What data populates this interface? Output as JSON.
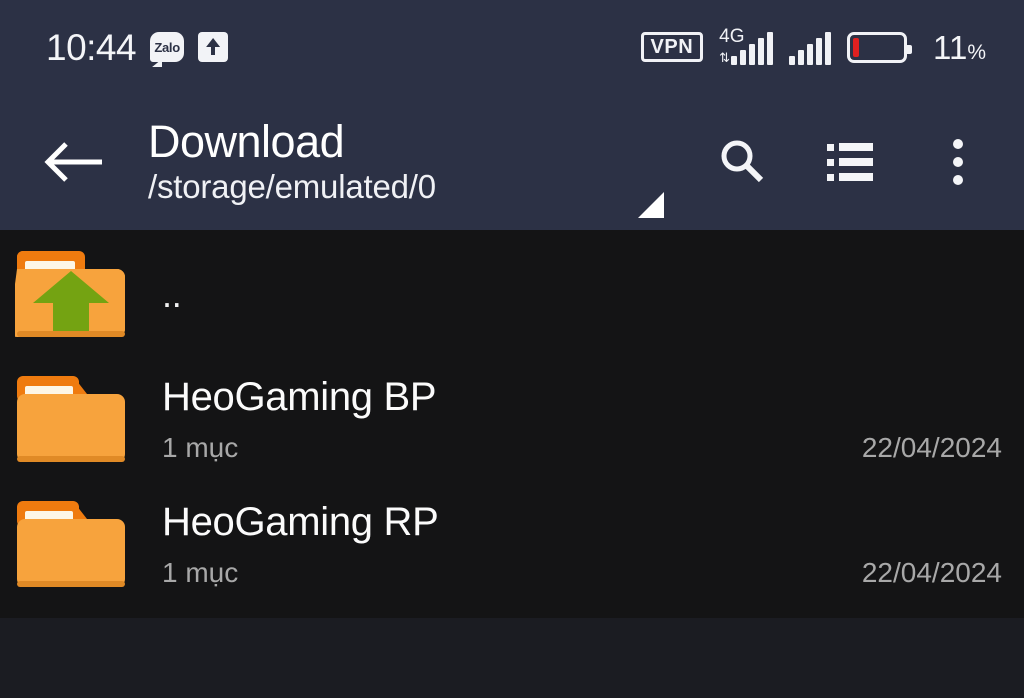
{
  "status_bar": {
    "clock": "10:44",
    "zalo_label": "Zalo",
    "upload_icon": "upload-arrow-icon",
    "vpn_label": "VPN",
    "network_generation": "4G",
    "data_arrows": "⇅",
    "signal_bars_1": 5,
    "signal_bars_2": 5,
    "battery_percent": "11",
    "battery_percent_symbol": "%",
    "battery_level": 11,
    "battery_color": "#e02020"
  },
  "toolbar": {
    "back_icon": "back-arrow-icon",
    "title": "Download",
    "subtitle": "/storage/emulated/0",
    "search_icon": "search-icon",
    "list_view_icon": "list-view-icon",
    "overflow_icon": "overflow-menu-icon",
    "resize_handle_icon": "resize-handle-icon",
    "background_color": "#2c3145"
  },
  "file_list": {
    "background_color": "#141415",
    "items": [
      {
        "icon": "folder-up-icon",
        "name": "..",
        "subtitle": "",
        "date": ""
      },
      {
        "icon": "folder-icon",
        "name": "HeoGaming BP",
        "subtitle": "1 mục",
        "date": "22/04/2024"
      },
      {
        "icon": "folder-icon",
        "name": "HeoGaming RP",
        "subtitle": "1 mục",
        "date": "22/04/2024"
      }
    ]
  },
  "colors": {
    "folder_front": "#f7a33d",
    "folder_back": "#ef7b0f",
    "folder_stripe": "#fdf6e6",
    "arrow_green": "#74a312",
    "text_primary": "#fbfbfb",
    "text_secondary": "#a8a8a8"
  }
}
